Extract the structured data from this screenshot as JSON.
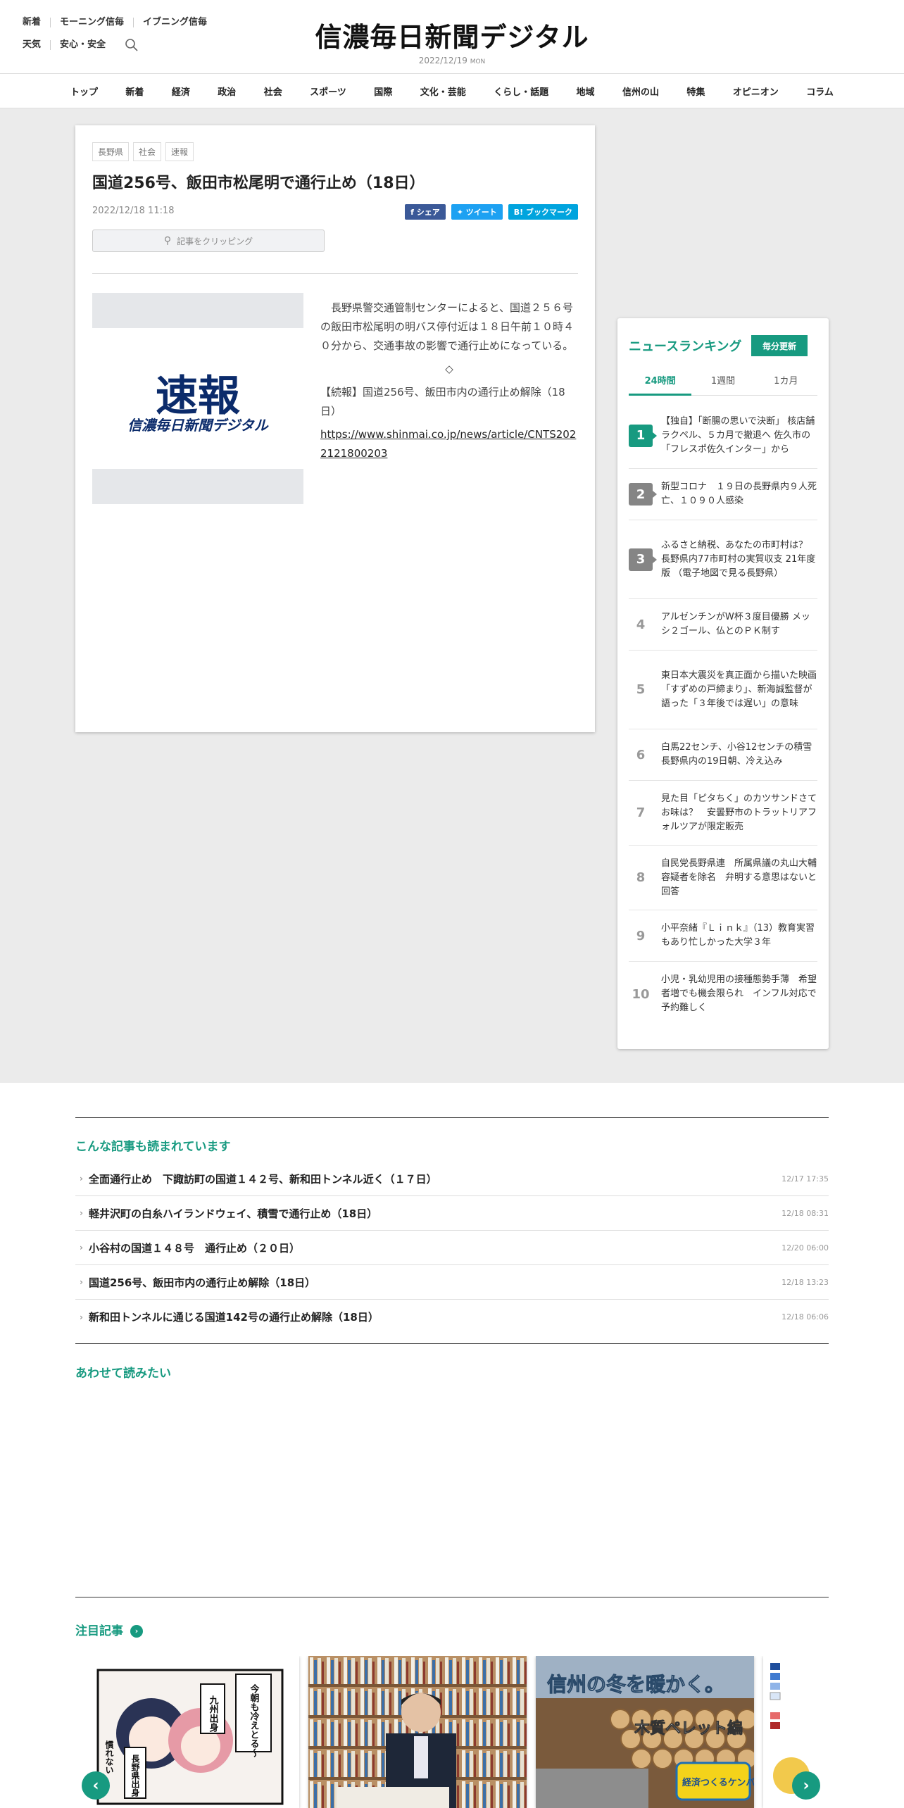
{
  "header": {
    "links_row1": [
      "新着",
      "モーニング信毎",
      "イブニング信毎"
    ],
    "links_row2": [
      "天気",
      "安心・安全"
    ],
    "logo": "信濃毎日新聞デジタル",
    "date": "2022/12/19",
    "weekday": "MON"
  },
  "nav": [
    "トップ",
    "新着",
    "経済",
    "政治",
    "社会",
    "スポーツ",
    "国際",
    "文化・芸能",
    "くらし・話題",
    "地域",
    "信州の山",
    "特集",
    "オピニオン",
    "コラム"
  ],
  "article": {
    "tags": [
      "長野県",
      "社会",
      "速報"
    ],
    "title": "国道256号、飯田市松尾明で通行止め（18日）",
    "date": "2022/12/18 11:18",
    "share": {
      "facebook": "シェア",
      "twitter": "ツイート",
      "hatena": "ブックマーク"
    },
    "clip_label": "記事をクリッピング",
    "image_title": "速報",
    "image_subtitle": "信濃毎日新聞デジタル",
    "body": "　長野県警交通管制センターによると、国道２５６号の飯田市松尾明の明バス停付近は１８日午前１０時４０分から、交通事故の影響で通行止めになっている。",
    "diamond": "◇",
    "followup": "【続報】国道256号、飯田市内の通行止め解除（18日）",
    "url": "https://www.shinmai.co.jp/news/article/CNTS2022121800203"
  },
  "ranking": {
    "title": "ニュースランキング",
    "update_label": "毎分更新",
    "tabs": [
      "24時間",
      "1週間",
      "1カ月"
    ],
    "items": [
      {
        "rank": "1",
        "text": "【独自】「断腸の思いで決断」 核店舗ラクペル、５カ月で撤退へ 佐久市の「フレスポ佐久インター」から"
      },
      {
        "rank": "2",
        "text": "新型コロナ　１９日の長野県内９人死亡、１０９０人感染"
      },
      {
        "rank": "3",
        "text": "ふるさと納税、あなたの市町村は？　長野県内77市町村の実質収支 21年度版 （電子地図で見る長野県）"
      },
      {
        "rank": "4",
        "text": "アルゼンチンがW杯３度目優勝 メッシ２ゴール、仏とのＰＫ制す"
      },
      {
        "rank": "5",
        "text": "東日本大震災を真正面から描いた映画「すずめの戸締まり」、新海誠監督が語った「３年後では遅い」の意味"
      },
      {
        "rank": "6",
        "text": "白馬22センチ、小谷12センチの積雪　長野県内の19日朝、冷え込み"
      },
      {
        "rank": "7",
        "text": "見た目「ピタちく」のカツサンドさてお味は？　安曇野市のトラットリアフォルツアが限定販売"
      },
      {
        "rank": "8",
        "text": "自民党長野県連　所属県議の丸山大輔容疑者を除名　弁明する意思はないと回答"
      },
      {
        "rank": "9",
        "text": "小平奈緒『Ｌｉｎｋ』（13）教育実習もあり忙しかった大学３年"
      },
      {
        "rank": "10",
        "text": "小児・乳幼児用の接種態勢手薄　希望者増でも機会限られ　インフル対応で予約難しく"
      }
    ]
  },
  "related": {
    "title": "こんな記事も読まれています",
    "items": [
      {
        "text": "全面通行止め　下諏訪町の国道１４２号、新和田トンネル近く（１７日）",
        "time": "12/17 17:35"
      },
      {
        "text": "軽井沢町の白糸ハイランドウェイ、積雪で通行止め（18日）",
        "time": "12/18 08:31"
      },
      {
        "text": "小谷村の国道１４８号　通行止め（２０日）",
        "time": "12/20 06:00"
      },
      {
        "text": "国道256号、飯田市内の通行止め解除（18日）",
        "time": "12/18 13:23"
      },
      {
        "text": "新和田トンネルに通じる国道142号の通行止め解除（18日）",
        "time": "12/18 06:06"
      }
    ]
  },
  "also_read": {
    "title": "あわせて読みたい"
  },
  "featured": {
    "title": "注目記事",
    "manga_bubble1": "九州出身",
    "manga_bubble2": "今朝も冷えとる〜",
    "manga_bubble3": "長野県出身",
    "manga_bubble4": "慣れない",
    "card3_headline": "信州の冬を暖かく。",
    "card3_sub": "木質ペレット編",
    "card3_badge": "経済つくるケンバ!",
    "prev": "‹",
    "next": "›"
  },
  "colors": {
    "accent": "#179a80",
    "band": "#ebebeb"
  }
}
